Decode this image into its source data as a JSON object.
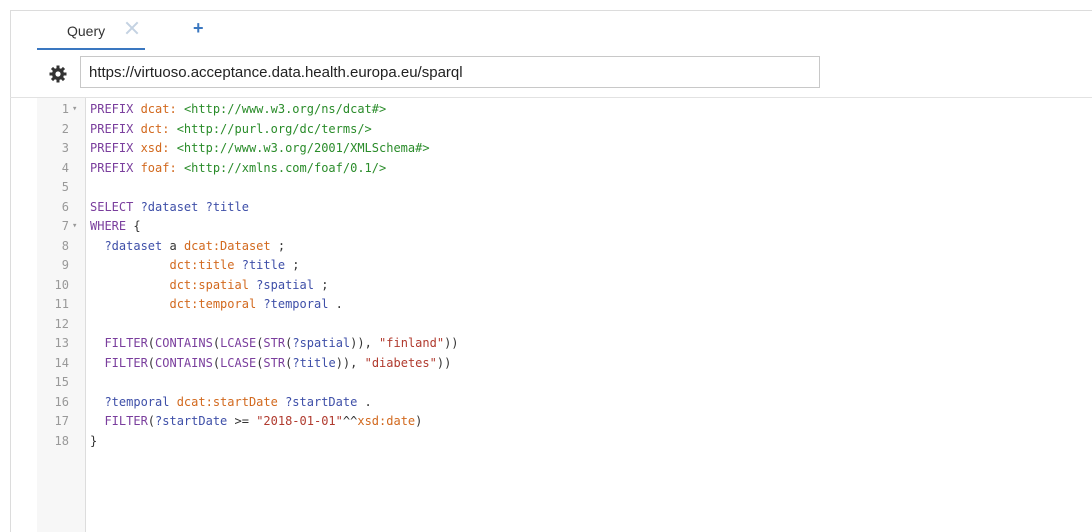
{
  "tabs": [
    {
      "label": "Query"
    }
  ],
  "endpoint": {
    "value": "https://virtuoso.acceptance.data.health.europa.eu/sparql"
  },
  "code_lines": [
    {
      "n": "1",
      "fold": true,
      "tokens": [
        [
          "kw",
          "PREFIX "
        ],
        [
          "pfx",
          "dcat: "
        ],
        [
          "iri",
          "<http://www.w3.org/ns/dcat#>"
        ]
      ]
    },
    {
      "n": "2",
      "tokens": [
        [
          "kw",
          "PREFIX "
        ],
        [
          "pfx",
          "dct: "
        ],
        [
          "iri",
          "<http://purl.org/dc/terms/>"
        ]
      ]
    },
    {
      "n": "3",
      "tokens": [
        [
          "kw",
          "PREFIX "
        ],
        [
          "pfx",
          "xsd: "
        ],
        [
          "iri",
          "<http://www.w3.org/2001/XMLSchema#>"
        ]
      ]
    },
    {
      "n": "4",
      "tokens": [
        [
          "kw",
          "PREFIX "
        ],
        [
          "pfx",
          "foaf: "
        ],
        [
          "iri",
          "<http://xmlns.com/foaf/0.1/>"
        ]
      ]
    },
    {
      "n": "5",
      "tokens": []
    },
    {
      "n": "6",
      "tokens": [
        [
          "kw",
          "SELECT "
        ],
        [
          "var",
          "?dataset "
        ],
        [
          "var",
          "?title"
        ]
      ]
    },
    {
      "n": "7",
      "fold": true,
      "tokens": [
        [
          "kw",
          "WHERE "
        ],
        [
          "pun",
          "{"
        ]
      ]
    },
    {
      "n": "8",
      "tokens": [
        [
          "var",
          "  ?dataset "
        ],
        [
          "pun",
          "a "
        ],
        [
          "pfx",
          "dcat:Dataset"
        ],
        [
          "pun",
          " ;"
        ]
      ]
    },
    {
      "n": "9",
      "tokens": [
        [
          "pfx",
          "           dct:title "
        ],
        [
          "var",
          "?title"
        ],
        [
          "pun",
          " ;"
        ]
      ]
    },
    {
      "n": "10",
      "tokens": [
        [
          "pfx",
          "           dct:spatial "
        ],
        [
          "var",
          "?spatial"
        ],
        [
          "pun",
          " ;"
        ]
      ]
    },
    {
      "n": "11",
      "tokens": [
        [
          "pfx",
          "           dct:temporal "
        ],
        [
          "var",
          "?temporal"
        ],
        [
          "pun",
          " ."
        ]
      ]
    },
    {
      "n": "12",
      "tokens": []
    },
    {
      "n": "13",
      "tokens": [
        [
          "kw",
          "  FILTER"
        ],
        [
          "pun",
          "("
        ],
        [
          "kw",
          "CONTAINS"
        ],
        [
          "pun",
          "("
        ],
        [
          "kw",
          "LCASE"
        ],
        [
          "pun",
          "("
        ],
        [
          "kw",
          "STR"
        ],
        [
          "pun",
          "("
        ],
        [
          "var",
          "?spatial"
        ],
        [
          "pun",
          ")), "
        ],
        [
          "str",
          "\"finland\""
        ],
        [
          "pun",
          "))"
        ]
      ]
    },
    {
      "n": "14",
      "tokens": [
        [
          "kw",
          "  FILTER"
        ],
        [
          "pun",
          "("
        ],
        [
          "kw",
          "CONTAINS"
        ],
        [
          "pun",
          "("
        ],
        [
          "kw",
          "LCASE"
        ],
        [
          "pun",
          "("
        ],
        [
          "kw",
          "STR"
        ],
        [
          "pun",
          "("
        ],
        [
          "var",
          "?title"
        ],
        [
          "pun",
          ")), "
        ],
        [
          "str",
          "\"diabetes\""
        ],
        [
          "pun",
          "))"
        ]
      ]
    },
    {
      "n": "15",
      "tokens": []
    },
    {
      "n": "16",
      "tokens": [
        [
          "var",
          "  ?temporal "
        ],
        [
          "pfx",
          "dcat:startDate "
        ],
        [
          "var",
          "?startDate"
        ],
        [
          "pun",
          " ."
        ]
      ]
    },
    {
      "n": "17",
      "tokens": [
        [
          "kw",
          "  FILTER"
        ],
        [
          "pun",
          "("
        ],
        [
          "var",
          "?startDate"
        ],
        [
          "pun",
          " >= "
        ],
        [
          "str",
          "\"2018-01-01\""
        ],
        [
          "pun",
          "^^"
        ],
        [
          "pfx",
          "xsd:date"
        ],
        [
          "pun",
          ")"
        ]
      ]
    },
    {
      "n": "18",
      "tokens": [
        [
          "pun",
          "}"
        ]
      ]
    }
  ],
  "colors": {
    "keyword": "#7a3e9d",
    "prefix": "#d2691e",
    "iri": "#2a8c2a",
    "variable": "#3e4fa8",
    "string": "#b03a2e",
    "tab_accent": "#3a77c0"
  },
  "icons": {
    "tab_close": "close-icon",
    "tab_add": "plus-icon",
    "settings": "gear-icon",
    "fold": "fold-triangle-icon"
  }
}
